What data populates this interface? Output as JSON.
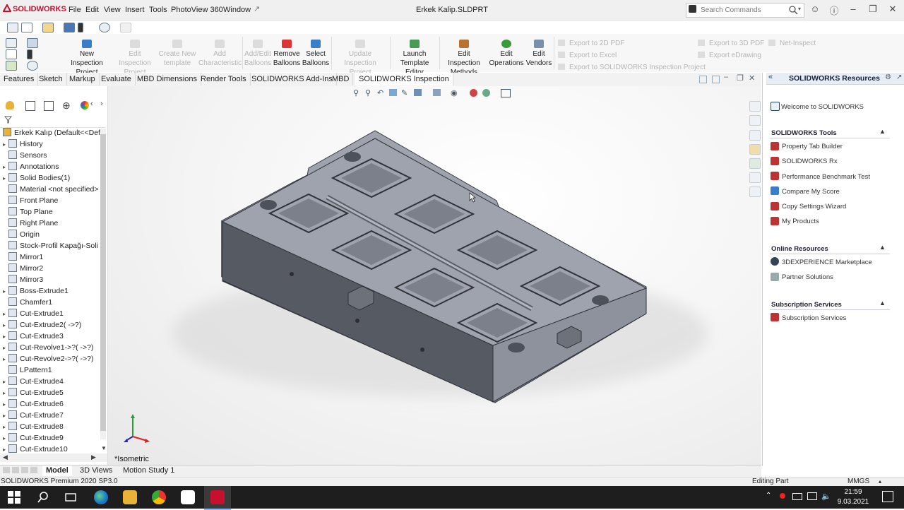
{
  "app": {
    "brand": "SOLIDWORKS",
    "menu": [
      "File",
      "Edit",
      "View",
      "Insert",
      "Tools",
      "PhotoView 360",
      "Window"
    ],
    "document_title": "Erkek Kalip.SLDPRT",
    "search_placeholder": "Search Commands",
    "brand_color": "#c8102e",
    "accent_color": "#3a7ec9"
  },
  "command_manager": {
    "buttons": [
      {
        "label1": "New Inspection",
        "label2": "Project",
        "enabled": true
      },
      {
        "label1": "Edit Inspection",
        "label2": "Project",
        "enabled": false
      },
      {
        "label1": "Create New",
        "label2": "template",
        "enabled": false
      },
      {
        "label1": "Add",
        "label2": "Characteristic",
        "enabled": false
      },
      {
        "label1": "Add/Edit",
        "label2": "Balloons",
        "enabled": false
      },
      {
        "label1": "Remove",
        "label2": "Balloons",
        "enabled": true
      },
      {
        "label1": "Select",
        "label2": "Balloons",
        "enabled": true
      },
      {
        "label1": "Update Inspection",
        "label2": "Project",
        "enabled": false
      },
      {
        "label1": "Launch",
        "label2": "Template Editor",
        "enabled": true
      },
      {
        "label1": "Edit Inspection",
        "label2": "Methods",
        "enabled": true
      },
      {
        "label1": "Edit",
        "label2": "Operations",
        "enabled": true
      },
      {
        "label1": "Edit",
        "label2": "Vendors",
        "enabled": true
      }
    ],
    "export_list_1": [
      "Export to 2D PDF",
      "Export to Excel",
      "Export to SOLIDWORKS Inspection Project"
    ],
    "export_list_2": [
      "Export to 3D PDF",
      "Export eDrawing"
    ],
    "net_inspect": "Net-Inspect"
  },
  "tabs": [
    "Features",
    "Sketch",
    "Markup",
    "Evaluate",
    "MBD Dimensions",
    "Render Tools",
    "SOLIDWORKS Add-Ins",
    "MBD",
    "SOLIDWORKS Inspection"
  ],
  "active_tab": "SOLIDWORKS Inspection",
  "feature_tree": {
    "root": "Erkek Kalıp  (Default<<Def",
    "items": [
      {
        "label": "History",
        "expandable": true
      },
      {
        "label": "Sensors",
        "expandable": false
      },
      {
        "label": "Annotations",
        "expandable": true
      },
      {
        "label": "Solid Bodies(1)",
        "expandable": true
      },
      {
        "label": "Material <not specified>",
        "expandable": false
      },
      {
        "label": "Front Plane",
        "expandable": false
      },
      {
        "label": "Top Plane",
        "expandable": false
      },
      {
        "label": "Right Plane",
        "expandable": false
      },
      {
        "label": "Origin",
        "expandable": false
      },
      {
        "label": "Stock-Profil Kapağı-Soli",
        "expandable": false
      },
      {
        "label": "Mirror1",
        "expandable": false
      },
      {
        "label": "Mirror2",
        "expandable": false
      },
      {
        "label": "Mirror3",
        "expandable": false
      },
      {
        "label": "Boss-Extrude1",
        "expandable": true
      },
      {
        "label": "Chamfer1",
        "expandable": false
      },
      {
        "label": "Cut-Extrude1",
        "expandable": true
      },
      {
        "label": "Cut-Extrude2( ->?)",
        "expandable": true
      },
      {
        "label": "Cut-Extrude3",
        "expandable": true
      },
      {
        "label": "Cut-Revolve1->?( ->?)",
        "expandable": true
      },
      {
        "label": "Cut-Revolve2->?( ->?)",
        "expandable": true
      },
      {
        "label": "LPattern1",
        "expandable": false
      },
      {
        "label": "Cut-Extrude4",
        "expandable": true
      },
      {
        "label": "Cut-Extrude5",
        "expandable": true
      },
      {
        "label": "Cut-Extrude6",
        "expandable": true
      },
      {
        "label": "Cut-Extrude7",
        "expandable": true
      },
      {
        "label": "Cut-Extrude8",
        "expandable": true
      },
      {
        "label": "Cut-Extrude9",
        "expandable": true
      },
      {
        "label": "Cut-Extrude10",
        "expandable": true
      }
    ]
  },
  "viewport": {
    "view_label": "*Isometric",
    "model_color": "#8d939e"
  },
  "task_pane": {
    "title": "SOLIDWORKS Resources",
    "welcome": "Welcome to SOLIDWORKS",
    "sections": [
      {
        "title": "SOLIDWORKS Tools",
        "items": [
          "Property Tab Builder",
          "SOLIDWORKS Rx",
          "Performance Benchmark Test",
          "Compare My Score",
          "Copy Settings Wizard",
          "My Products"
        ]
      },
      {
        "title": "Online Resources",
        "items": [
          "3DEXPERIENCE Marketplace",
          "Partner Solutions"
        ]
      },
      {
        "title": "Subscription Services",
        "items": [
          "Subscription Services"
        ]
      }
    ]
  },
  "bottom_tabs": [
    "Model",
    "3D Views",
    "Motion Study 1"
  ],
  "status": {
    "left": "SOLIDWORKS Premium 2020 SP3.0",
    "mode": "Editing Part",
    "units": "MMGS"
  },
  "taskbar": {
    "time": "21:59",
    "date": "9.03.2021"
  }
}
